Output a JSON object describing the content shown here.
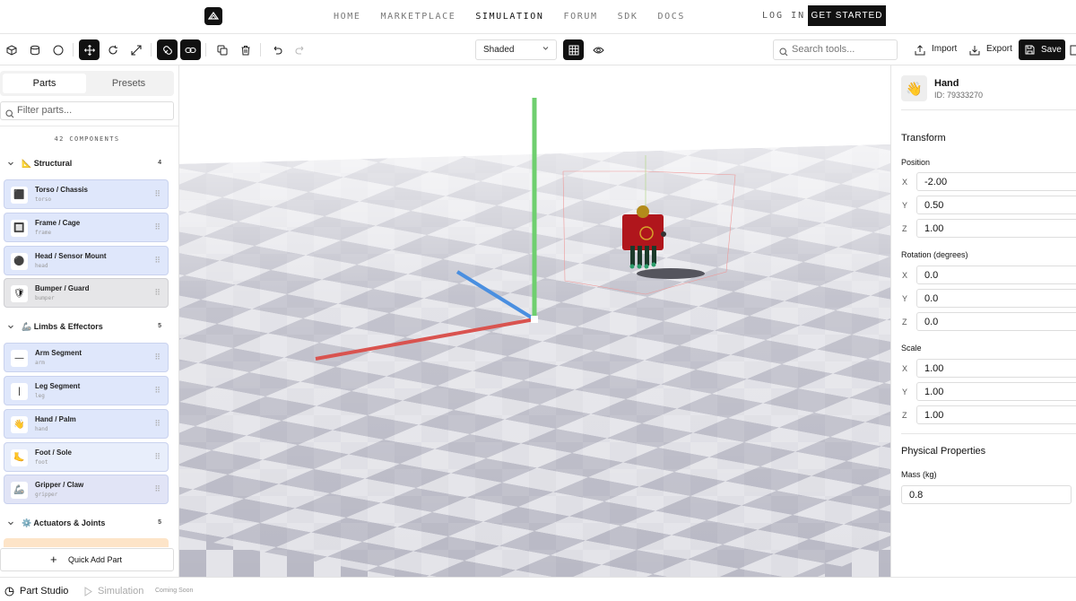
{
  "nav": {
    "links": [
      "HOME",
      "MARKETPLACE",
      "SIMULATION",
      "FORUM",
      "SDK",
      "DOCS"
    ],
    "active": "SIMULATION",
    "login": "LOG IN",
    "cta": "GET STARTED"
  },
  "toolbar": {
    "render_mode": "Shaded",
    "search_placeholder": "Search tools...",
    "import_label": "Import",
    "export_label": "Export",
    "save_label": "Save"
  },
  "left_panel": {
    "tabs": [
      "Parts",
      "Presets"
    ],
    "active_tab": "Parts",
    "filter_placeholder": "Filter parts...",
    "components_count": "42 COMPONENTS",
    "groups": [
      {
        "label": "📐 Structural",
        "count": "4",
        "items": [
          {
            "name": "Torso / Chassis",
            "id": "torso",
            "icon": "⬛"
          },
          {
            "name": "Frame / Cage",
            "id": "frame",
            "icon": "🔲"
          },
          {
            "name": "Head / Sensor Mount",
            "id": "head",
            "icon": "⚫"
          },
          {
            "name": "Bumper / Guard",
            "id": "bumper",
            "icon": "🛡"
          }
        ]
      },
      {
        "label": "🦾 Limbs & Effectors",
        "count": "5",
        "items": [
          {
            "name": "Arm Segment",
            "id": "arm",
            "icon": "—"
          },
          {
            "name": "Leg Segment",
            "id": "leg",
            "icon": "|"
          },
          {
            "name": "Hand / Palm",
            "id": "hand",
            "icon": "👋"
          },
          {
            "name": "Foot / Sole",
            "id": "foot",
            "icon": "🦶"
          },
          {
            "name": "Gripper / Claw",
            "id": "gripper",
            "icon": "🦾"
          }
        ]
      },
      {
        "label": "⚙️ Actuators & Joints",
        "count": "5",
        "items": []
      }
    ],
    "quick_add": "Quick Add Part"
  },
  "inspector": {
    "name": "Hand",
    "id_label": "ID: 79333270",
    "transform_title": "Transform",
    "position_label": "Position",
    "position": {
      "X": "-2.00",
      "Y": "0.50",
      "Z": "1.00"
    },
    "rotation_label": "Rotation (degrees)",
    "rotation": {
      "X": "0.0",
      "Y": "0.0",
      "Z": "0.0"
    },
    "scale_label": "Scale",
    "scale": {
      "X": "1.00",
      "Y": "1.00",
      "Z": "1.00"
    },
    "physical_title": "Physical Properties",
    "mass_label": "Mass (kg)",
    "mass": "0.8"
  },
  "status_bar": {
    "part_studio": "Part Studio",
    "simulation": "Simulation",
    "coming_soon": "Coming Soon"
  },
  "colors": {
    "accent": "#111111",
    "axis_x": "#d9534f",
    "axis_y": "#6fcf6f",
    "axis_z": "#4a8fe0",
    "card_bg": "#dfe7fb",
    "robot": "#b0161c"
  }
}
